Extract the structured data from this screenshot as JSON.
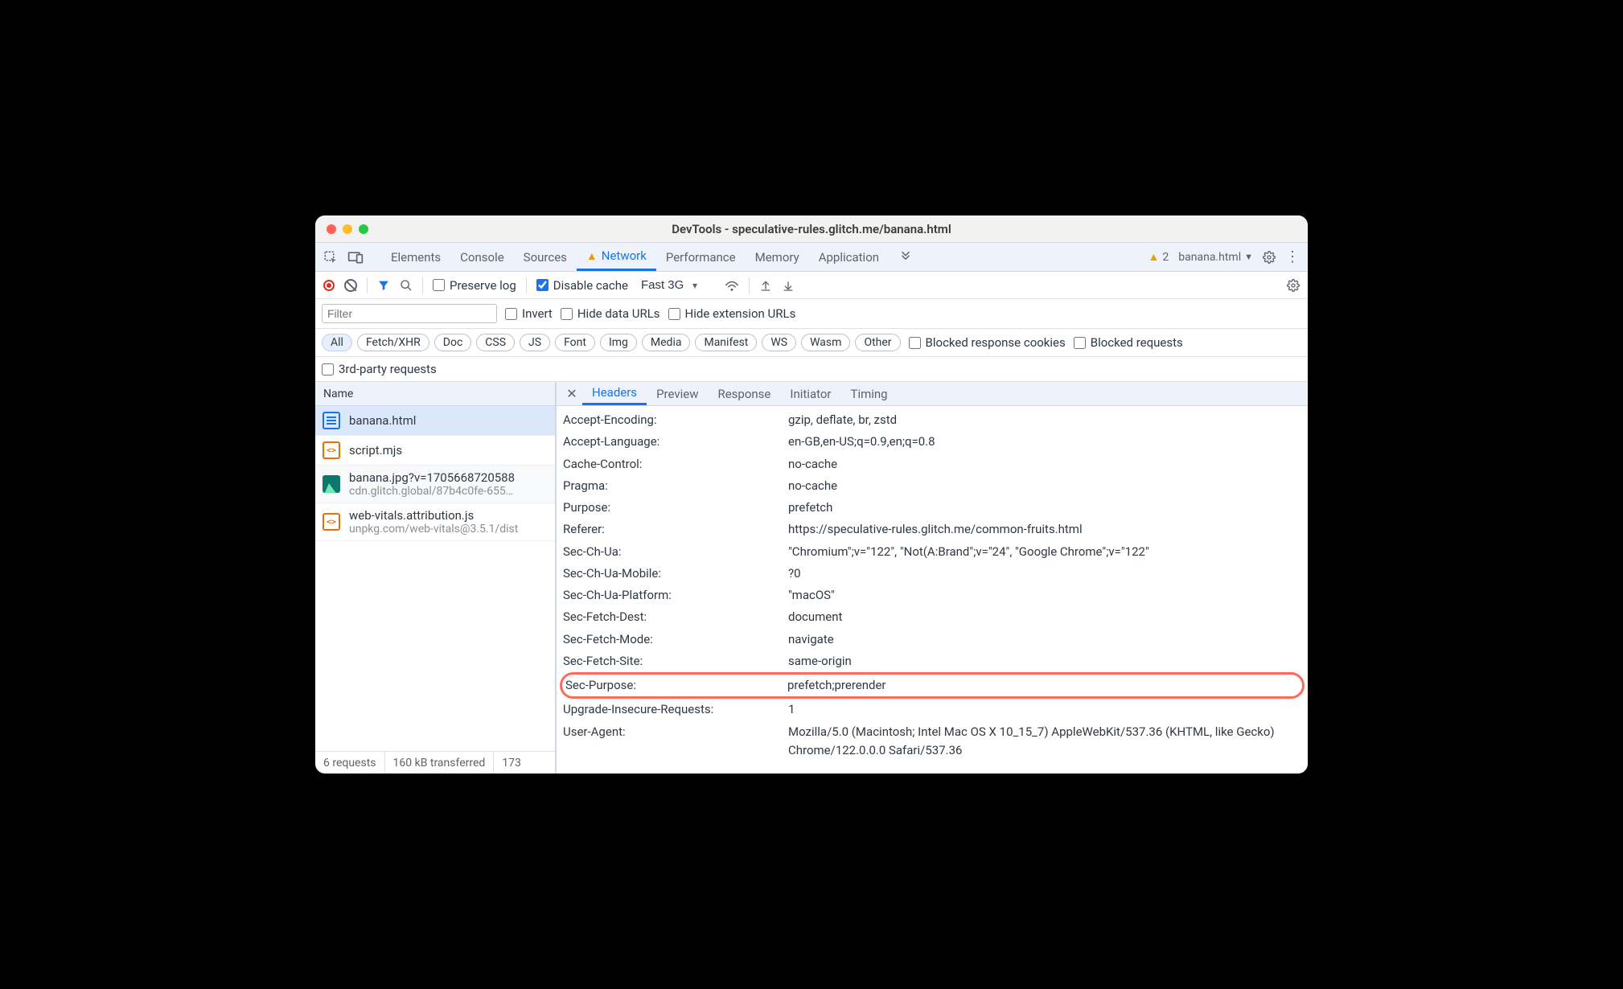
{
  "window": {
    "title": "DevTools - speculative-rules.glitch.me/banana.html"
  },
  "tabs": {
    "items": [
      "Elements",
      "Console",
      "Sources",
      "Network",
      "Performance",
      "Memory",
      "Application"
    ],
    "active": "Network",
    "warn_on": "Network",
    "warning_count": "2",
    "context_label": "banana.html"
  },
  "toolbar": {
    "preserve_log": "Preserve log",
    "disable_cache": "Disable cache",
    "disable_cache_checked": true,
    "throttle_value": "Fast 3G"
  },
  "filters": {
    "filter_placeholder": "Filter",
    "invert": "Invert",
    "hide_data": "Hide data URLs",
    "hide_ext": "Hide extension URLs",
    "types": [
      "All",
      "Fetch/XHR",
      "Doc",
      "CSS",
      "JS",
      "Font",
      "Img",
      "Media",
      "Manifest",
      "WS",
      "Wasm",
      "Other"
    ],
    "type_active": "All",
    "blocked_cookies": "Blocked response cookies",
    "blocked_requests": "Blocked requests",
    "third_party": "3rd-party requests"
  },
  "name_header": "Name",
  "requests": [
    {
      "icon": "doc",
      "name": "banana.html",
      "sub": "",
      "selected": true
    },
    {
      "icon": "js",
      "name": "script.mjs",
      "sub": ""
    },
    {
      "icon": "img",
      "name": "banana.jpg?v=1705668720588",
      "sub": "cdn.glitch.global/87b4c0fe-655…"
    },
    {
      "icon": "js",
      "name": "web-vitals.attribution.js",
      "sub": "unpkg.com/web-vitals@3.5.1/dist"
    }
  ],
  "detail_tabs": [
    "Headers",
    "Preview",
    "Response",
    "Initiator",
    "Timing"
  ],
  "detail_active": "Headers",
  "headers": [
    {
      "k": "Accept-Encoding:",
      "v": "gzip, deflate, br, zstd"
    },
    {
      "k": "Accept-Language:",
      "v": "en-GB,en-US;q=0.9,en;q=0.8"
    },
    {
      "k": "Cache-Control:",
      "v": "no-cache"
    },
    {
      "k": "Pragma:",
      "v": "no-cache"
    },
    {
      "k": "Purpose:",
      "v": "prefetch"
    },
    {
      "k": "Referer:",
      "v": "https://speculative-rules.glitch.me/common-fruits.html"
    },
    {
      "k": "Sec-Ch-Ua:",
      "v": "\"Chromium\";v=\"122\", \"Not(A:Brand\";v=\"24\", \"Google Chrome\";v=\"122\""
    },
    {
      "k": "Sec-Ch-Ua-Mobile:",
      "v": "?0"
    },
    {
      "k": "Sec-Ch-Ua-Platform:",
      "v": "\"macOS\""
    },
    {
      "k": "Sec-Fetch-Dest:",
      "v": "document"
    },
    {
      "k": "Sec-Fetch-Mode:",
      "v": "navigate"
    },
    {
      "k": "Sec-Fetch-Site:",
      "v": "same-origin"
    },
    {
      "k": "Sec-Purpose:",
      "v": "prefetch;prerender",
      "highlight": true
    },
    {
      "k": "Upgrade-Insecure-Requests:",
      "v": "1"
    },
    {
      "k": "User-Agent:",
      "v": "Mozilla/5.0 (Macintosh; Intel Mac OS X 10_15_7) AppleWebKit/537.36 (KHTML, like Gecko) Chrome/122.0.0.0 Safari/537.36"
    }
  ],
  "status": {
    "requests": "6 requests",
    "transferred": "160 kB transferred",
    "resources": "173"
  }
}
